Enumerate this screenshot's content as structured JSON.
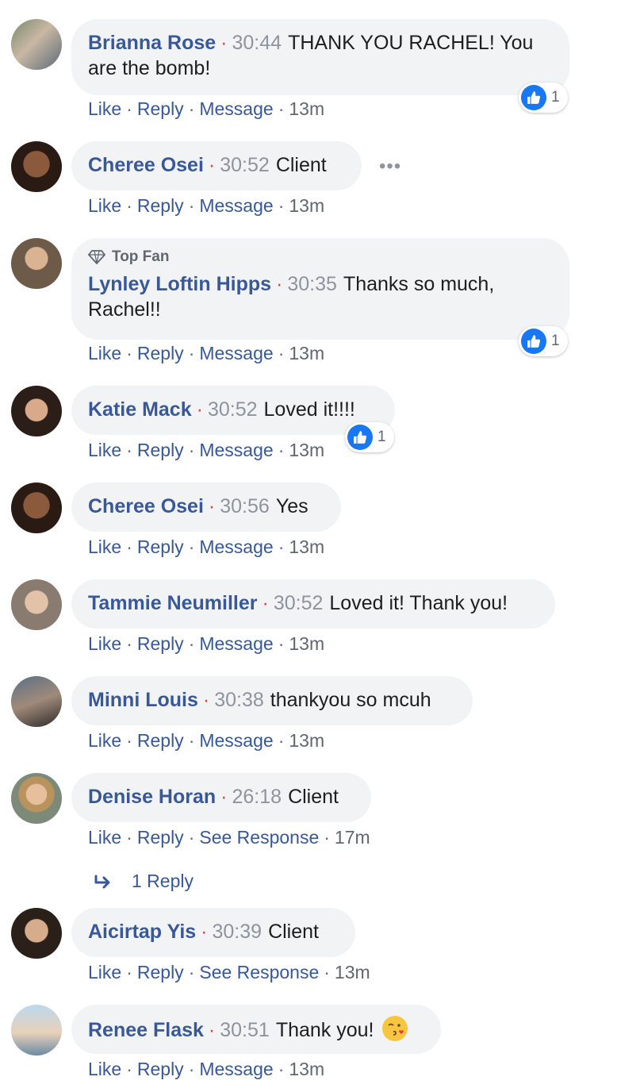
{
  "comments": [
    {
      "author": "Brianna Rose",
      "time": "30:44",
      "text": "THANK YOU RACHEL! You are the bomb!",
      "actions": [
        "Like",
        "Reply",
        "Message"
      ],
      "age": "13m",
      "reactions": "1"
    },
    {
      "author": "Cheree Osei",
      "time": "30:52",
      "text": "Client",
      "actions": [
        "Like",
        "Reply",
        "Message"
      ],
      "age": "13m",
      "more": "•••"
    },
    {
      "badge": "Top Fan",
      "author": "Lynley Loftin Hipps",
      "time": "30:35",
      "text": "Thanks so much, Rachel!!",
      "actions": [
        "Like",
        "Reply",
        "Message"
      ],
      "age": "13m",
      "reactions": "1"
    },
    {
      "author": "Katie Mack",
      "time": "30:52",
      "text": "Loved it!!!!",
      "actions": [
        "Like",
        "Reply",
        "Message"
      ],
      "age": "13m",
      "reactions": "1"
    },
    {
      "author": "Cheree Osei",
      "time": "30:56",
      "text": "Yes",
      "actions": [
        "Like",
        "Reply",
        "Message"
      ],
      "age": "13m"
    },
    {
      "author": "Tammie Neumiller",
      "time": "30:52",
      "text": "Loved it! Thank you!",
      "actions": [
        "Like",
        "Reply",
        "Message"
      ],
      "age": "13m"
    },
    {
      "author": "Minni Louis",
      "time": "30:38",
      "text": "thankyou so mcuh",
      "actions": [
        "Like",
        "Reply",
        "Message"
      ],
      "age": "13m"
    },
    {
      "author": "Denise Horan",
      "time": "26:18",
      "text": "Client",
      "actions": [
        "Like",
        "Reply",
        "See Response"
      ],
      "age": "17m"
    },
    {
      "author": "Aicirtap Yis",
      "time": "30:39",
      "text": "Client",
      "actions": [
        "Like",
        "Reply",
        "See Response"
      ],
      "age": "13m"
    },
    {
      "author": "Renee Flask",
      "time": "30:51",
      "text": "Thank you!",
      "actions": [
        "Like",
        "Reply",
        "Message"
      ],
      "age": "13m"
    }
  ],
  "replies_link": "1 Reply",
  "icons": {
    "reaction": "like-thumb-icon",
    "badge": "diamond-icon",
    "reply": "reply-arrow-icon",
    "emoji": "kissing-face-emoji"
  },
  "colors": {
    "author": "#385898",
    "bubble": "#f2f3f5",
    "like_blue": "#1877f2",
    "timestamp": "#8d949e",
    "dot": "#e0413f"
  }
}
